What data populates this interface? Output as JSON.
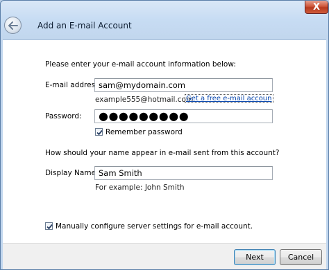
{
  "window": {
    "title": "Add an E-mail Account",
    "close_label": "X"
  },
  "form": {
    "instructions": "Please enter your e-mail account information below:",
    "email": {
      "label": "E-mail address:",
      "value": "sam@mydomain.com",
      "example": "example555@hotmail.com",
      "link": "Get a free e-mail accoun"
    },
    "password": {
      "label": "Password:",
      "value": "●●●●●●●●●"
    },
    "remember_password": {
      "label": "Remember password",
      "checked": true
    },
    "name_prompt": "How should your name appear in e-mail sent from this account?",
    "display_name": {
      "label": "Display Name:",
      "value": "Sam Smith",
      "example": "For example: John Smith"
    },
    "manual_config": {
      "label": "Manually configure server settings for e-mail account.",
      "checked": true
    }
  },
  "buttons": {
    "next": "Next",
    "cancel": "Cancel"
  }
}
